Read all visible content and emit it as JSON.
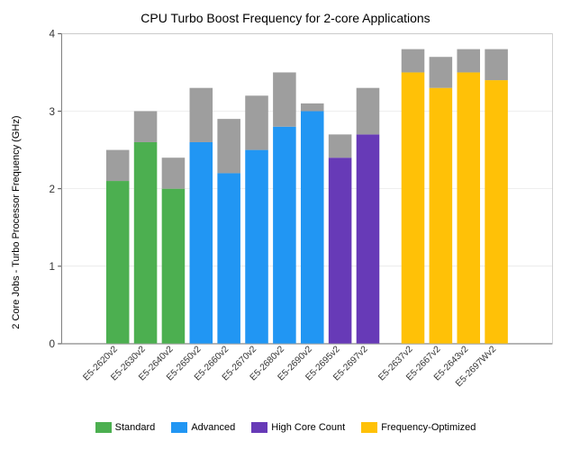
{
  "title": "CPU Turbo Boost Frequency for 2-core Applications",
  "yAxisLabel": "2 Core Jobs - Turbo Processor Frequency (GHz)",
  "yMin": 0,
  "yMax": 4,
  "yTicks": [
    0,
    1,
    2,
    3,
    4
  ],
  "colors": {
    "standard": "#4caf50",
    "advanced": "#2196f3",
    "highCoreCount": "#673ab7",
    "frequencyOptimized": "#ffc107",
    "gray": "#9e9e9e"
  },
  "legend": [
    {
      "label": "Standard",
      "color": "#4caf50"
    },
    {
      "label": "Advanced",
      "color": "#2196f3"
    },
    {
      "label": "High Core Count",
      "color": "#673ab7"
    },
    {
      "label": "Frequency-Optimized",
      "color": "#ffc107"
    }
  ],
  "bars": [
    {
      "x_label": "E5-2620v2",
      "type": "standard",
      "base": 0,
      "solid": 2.1,
      "top": 2.5
    },
    {
      "x_label": "E5-2630v2",
      "type": "standard",
      "base": 0,
      "solid": 2.6,
      "top": 3.0
    },
    {
      "x_label": "E5-2640v2",
      "type": "standard",
      "base": 0,
      "solid": 2.0,
      "top": 2.4
    },
    {
      "x_label": "E5-2650v2",
      "type": "advanced",
      "base": 0,
      "solid": 2.6,
      "top": 3.3
    },
    {
      "x_label": "E5-2660v2",
      "type": "advanced",
      "base": 0,
      "solid": 2.2,
      "top": 2.9
    },
    {
      "x_label": "E5-2670v2",
      "type": "advanced",
      "base": 0,
      "solid": 2.5,
      "top": 3.2
    },
    {
      "x_label": "E5-2680v2",
      "type": "advanced",
      "base": 0,
      "solid": 2.8,
      "top": 3.5
    },
    {
      "x_label": "E5-2690v2",
      "type": "advanced",
      "base": 0,
      "solid": 3.0,
      "top": 3.1
    },
    {
      "x_label": "E5-2695v2",
      "type": "highCoreCount",
      "base": 0,
      "solid": 2.4,
      "top": 2.7
    },
    {
      "x_label": "E5-2697v2",
      "type": "highCoreCount",
      "base": 0,
      "solid": 2.7,
      "top": 3.3
    },
    {
      "x_label": "E5-2637v2",
      "type": "frequencyOptimized",
      "base": 0,
      "solid": 3.5,
      "top": 3.8
    },
    {
      "x_label": "E5-2667v2",
      "type": "frequencyOptimized",
      "base": 0,
      "solid": 3.3,
      "top": 3.7
    },
    {
      "x_label": "E5-2643v2",
      "type": "frequencyOptimized",
      "base": 0,
      "solid": 3.5,
      "top": 3.8
    },
    {
      "x_label": "E5-2697Wv2",
      "type": "frequencyOptimized",
      "base": 0,
      "solid": 3.4,
      "top": 3.8
    }
  ]
}
